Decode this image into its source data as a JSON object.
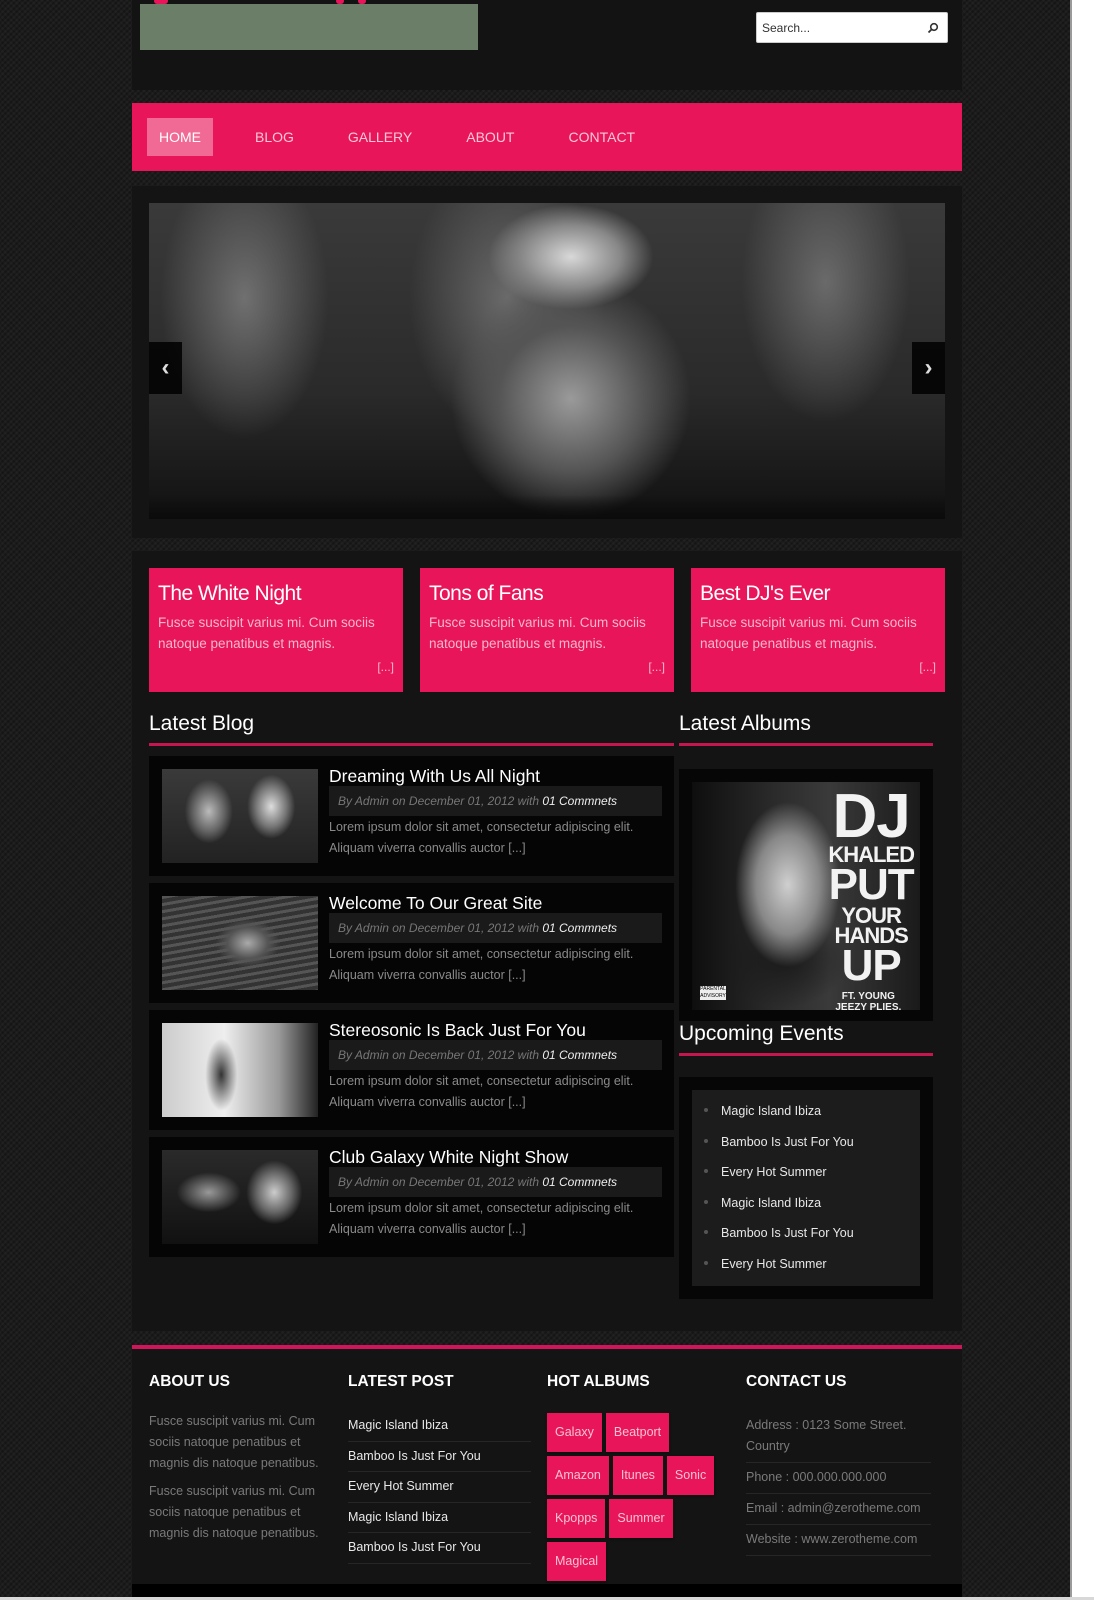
{
  "header": {
    "search": {
      "placeholder": "Search...",
      "value": "",
      "icon": "search-icon"
    },
    "logo_colors": {
      "box": "#6b7f68",
      "accent": "#e8155a"
    }
  },
  "nav": {
    "items": [
      {
        "label": "HOME",
        "active": true
      },
      {
        "label": "BLOG",
        "active": false
      },
      {
        "label": "GALLERY",
        "active": false
      },
      {
        "label": "ABOUT",
        "active": false
      },
      {
        "label": "CONTACT",
        "active": false
      }
    ]
  },
  "slider": {
    "prev_icon": "‹",
    "next_icon": "›"
  },
  "features": [
    {
      "title": "The White Night",
      "text": "Fusce suscipit varius mi. Cum sociis natoque penatibus et magnis.",
      "more": "[...]"
    },
    {
      "title": "Tons of Fans",
      "text": "Fusce suscipit varius mi. Cum sociis natoque penatibus et magnis.",
      "more": "[...]"
    },
    {
      "title": "Best DJ's Ever",
      "text": "Fusce suscipit varius mi. Cum sociis natoque penatibus et magnis.",
      "more": "[...]"
    }
  ],
  "latest_blog": {
    "title": "Latest Blog",
    "posts": [
      {
        "title": "Dreaming With Us All Night",
        "meta": "By Admin on December 01, 2012 with ",
        "comments": "01 Commnets",
        "excerpt": "Lorem ipsum dolor sit amet, consectetur adipiscing elit. Aliquam viverra convallis auctor [...]"
      },
      {
        "title": "Welcome To Our Great Site",
        "meta": "By Admin on December 01, 2012 with ",
        "comments": "01 Commnets",
        "excerpt": "Lorem ipsum dolor sit amet, consectetur adipiscing elit. Aliquam viverra convallis auctor [...]"
      },
      {
        "title": "Stereosonic Is Back Just For You",
        "meta": "By Admin on December 01, 2012 with ",
        "comments": "01 Commnets",
        "excerpt": "Lorem ipsum dolor sit amet, consectetur adipiscing elit. Aliquam viverra convallis auctor [...]"
      },
      {
        "title": "Club Galaxy White Night Show",
        "meta": "By Admin on December 01, 2012 with ",
        "comments": "01 Commnets",
        "excerpt": "Lorem ipsum dolor sit amet, consectetur adipiscing elit. Aliquam viverra convallis auctor [...]"
      }
    ]
  },
  "latest_albums": {
    "title": "Latest Albums",
    "cover": {
      "line1": "DJ",
      "line2": "KHALED",
      "line3": "PUT",
      "line4": "YOUR",
      "line5": "HANDS",
      "line6": "UP",
      "featuring": "FT. YOUNG JEEZY PLIES, RICK ROSS & SCHIFE",
      "advisory": "PARENTAL ADVISORY"
    }
  },
  "upcoming_events": {
    "title": "Upcoming Events",
    "items": [
      "Magic Island Ibiza",
      "Bamboo Is Just For You",
      "Every Hot Summer",
      "Magic Island Ibiza",
      "Bamboo Is Just For You",
      "Every Hot Summer"
    ]
  },
  "footer": {
    "about": {
      "title": "ABOUT US",
      "paragraphs": [
        "Fusce suscipit varius mi. Cum sociis natoque penatibus et magnis dis natoque penatibus.",
        "Fusce suscipit varius mi. Cum sociis natoque penatibus et magnis dis natoque penatibus."
      ]
    },
    "latest_post": {
      "title": "LATEST POST",
      "items": [
        "Magic Island Ibiza",
        "Bamboo Is Just For You",
        "Every Hot Summer",
        "Magic Island Ibiza",
        "Bamboo Is Just For You"
      ]
    },
    "hot_albums": {
      "title": "HOT ALBUMS",
      "tags": [
        "Galaxy",
        "Beatport",
        "Amazon",
        "Itunes",
        "Sonic",
        "Kpopps",
        "Summer",
        "Magical"
      ]
    },
    "contact": {
      "title": "CONTACT US",
      "items": [
        "Address : 0123 Some Street. Country",
        "Phone : 000.000.000.000",
        "Email : admin@zerotheme.com",
        "Website : www.zerotheme.com"
      ]
    }
  },
  "colors": {
    "accent": "#e8155a",
    "nav_active": "#f06a95",
    "panel": "#141414",
    "rule": "#c51650"
  }
}
